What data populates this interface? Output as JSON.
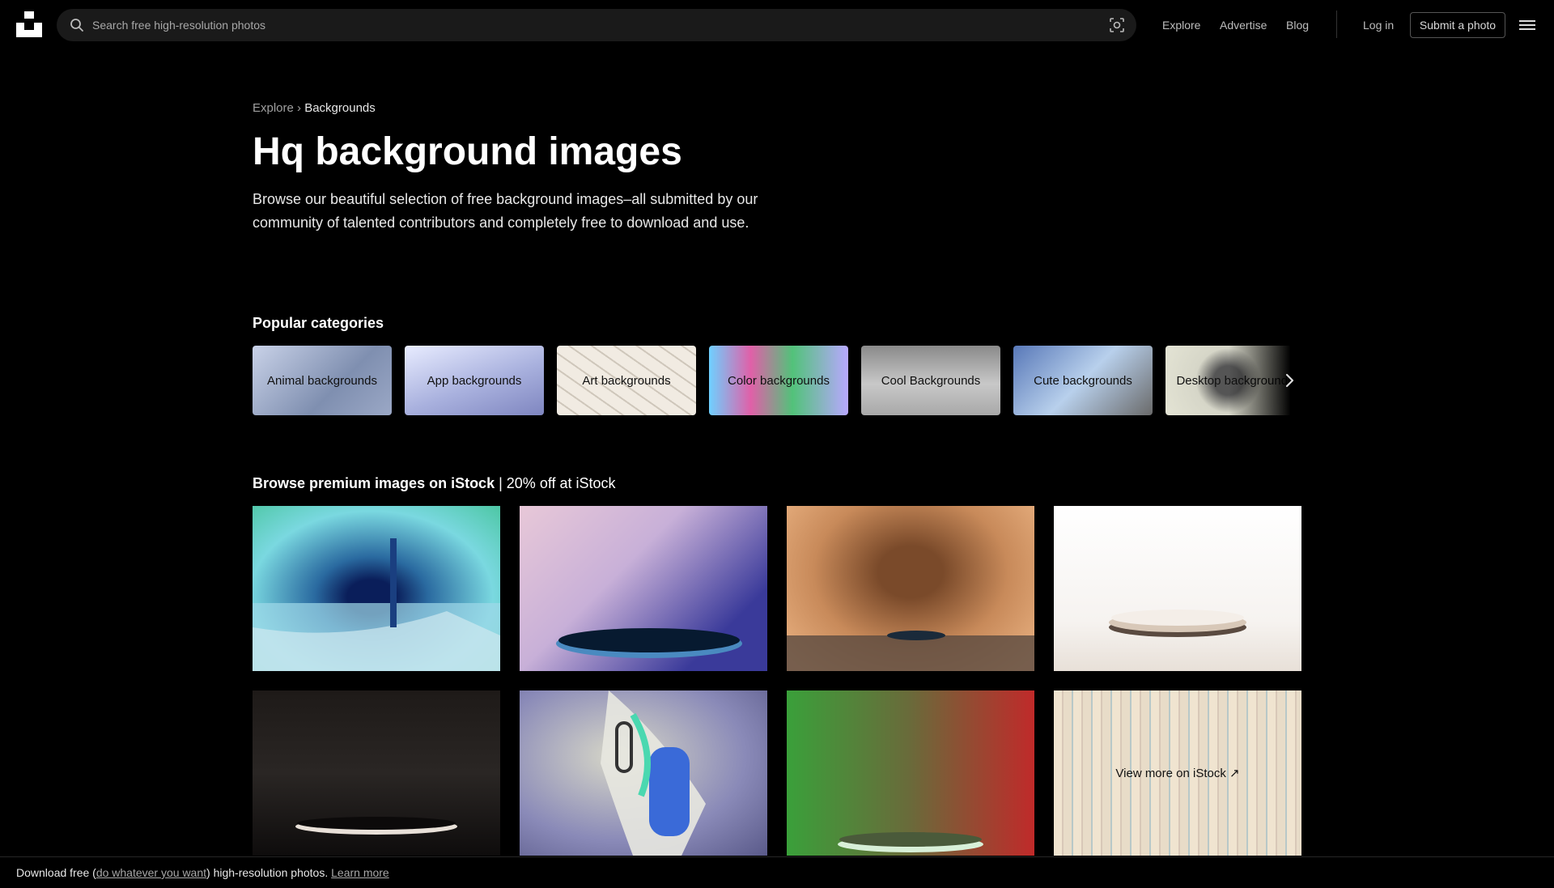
{
  "header": {
    "search_placeholder": "Search free high-resolution photos",
    "nav": {
      "explore": "Explore",
      "advertise": "Advertise",
      "blog": "Blog",
      "login": "Log in",
      "submit": "Submit a photo"
    }
  },
  "hero": {
    "breadcrumb": {
      "root": "Explore",
      "separator": "›",
      "current": "Backgrounds"
    },
    "title": "Hq background images",
    "description": "Browse our beautiful selection of free background images–all submitted by our community of talented contributors and completely free to download and use."
  },
  "categories": {
    "title": "Popular categories",
    "items": [
      {
        "label": "Animal backgrounds",
        "color": "#9aa6c4"
      },
      {
        "label": "App backgrounds",
        "color": "#b8c0e6"
      },
      {
        "label": "Art backgrounds",
        "color": "#e8e2d8"
      },
      {
        "label": "Color backgrounds",
        "color": "#b07ad6"
      },
      {
        "label": "Cool Backgrounds",
        "color": "#b4b4b4"
      },
      {
        "label": "Cute backgrounds",
        "color": "#8ca0c8"
      },
      {
        "label": "Desktop backgrounds",
        "color": "#cfcfc0"
      }
    ]
  },
  "istock": {
    "title_bold": "Browse premium images on iStock",
    "title_rest": "| 20% off at iStock",
    "view_more": "View more on iStock ↗"
  },
  "footer": {
    "prefix": "Download free (",
    "link1": "do whatever you want",
    "middle": ") high-resolution photos.",
    "link2": "Learn more"
  }
}
